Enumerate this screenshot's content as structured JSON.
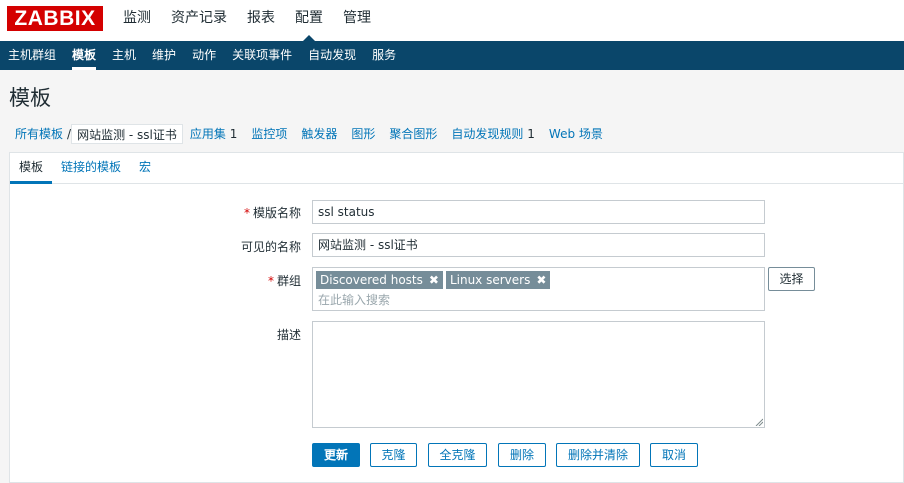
{
  "logo": "ZABBIX",
  "main_menu": [
    {
      "label": "监测"
    },
    {
      "label": "资产记录"
    },
    {
      "label": "报表"
    },
    {
      "label": "配置"
    },
    {
      "label": "管理"
    }
  ],
  "sub_menu": [
    {
      "label": "主机群组"
    },
    {
      "label": "模板"
    },
    {
      "label": "主机"
    },
    {
      "label": "维护"
    },
    {
      "label": "动作"
    },
    {
      "label": "关联项事件"
    },
    {
      "label": "自动发现"
    },
    {
      "label": "服务"
    }
  ],
  "page_title": "模板",
  "object_nav": {
    "all_templates": "所有模板",
    "separator": "/",
    "current": "网站监测 - ssl证书",
    "applications": "应用集",
    "applications_count": "1",
    "items": "监控项",
    "triggers": "触发器",
    "graphs": "图形",
    "screens": "聚合图形",
    "discovery": "自动发现规则",
    "discovery_count": "1",
    "web": "Web 场景"
  },
  "tabs": [
    {
      "label": "模板"
    },
    {
      "label": "链接的模板"
    },
    {
      "label": "宏"
    }
  ],
  "form": {
    "template_name_label": "模版名称",
    "template_name_value": "ssl status",
    "visible_name_label": "可见的名称",
    "visible_name_value": "网站监测 - ssl证书",
    "groups_label": "群组",
    "groups": [
      {
        "label": "Discovered hosts"
      },
      {
        "label": "Linux servers"
      }
    ],
    "groups_placeholder": "在此输入搜索",
    "select_button": "选择",
    "description_label": "描述",
    "required_mark": "*",
    "remove_icon": "✖"
  },
  "buttons": {
    "update": "更新",
    "clone": "克隆",
    "full_clone": "全克隆",
    "delete": "删除",
    "delete_and_clear": "删除并清除",
    "cancel": "取消"
  },
  "colors": {
    "brand_red": "#d40000",
    "nav_blue": "#0a466a",
    "link_blue": "#0275b8",
    "chip_gray": "#768d99"
  }
}
